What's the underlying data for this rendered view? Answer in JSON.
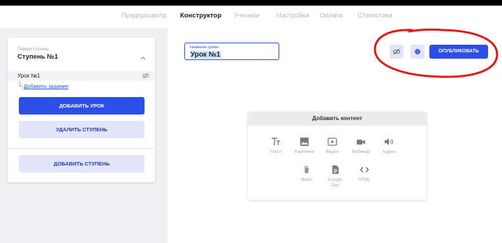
{
  "nav": {
    "tabs": [
      {
        "label": "Предпросмотр",
        "active": false
      },
      {
        "label": "Конструктор",
        "active": true
      },
      {
        "label": "Ученики",
        "active": false
      },
      {
        "label": "Настройки",
        "active": false
      },
      {
        "label": "Оплата",
        "active": false
      },
      {
        "label": "Статистика",
        "active": false
      }
    ]
  },
  "sidebar": {
    "stage_sub": "Первая ступень",
    "stage_title": "Ступень №1",
    "lesson_label": "Урок №1",
    "add_task_link": "Добавить задание",
    "add_lesson_button": "ДОБАВИТЬ УРОК",
    "delete_stage_button": "УДАЛИТЬ СТУПЕНЬ",
    "add_stage_button": "ДОБАВИТЬ СТУПЕНЬ"
  },
  "editor": {
    "lesson_name_label": "Название урока",
    "lesson_name_value": "Урок №1",
    "publish_button": "ОПУБЛИКОВАТЬ"
  },
  "content": {
    "title": "Добавить контент",
    "items": [
      {
        "label": "Текст",
        "icon": "text-icon"
      },
      {
        "label": "Картинка",
        "icon": "image-icon"
      },
      {
        "label": "Видео",
        "icon": "video-icon"
      },
      {
        "label": "Вебинар",
        "icon": "webinar-icon"
      },
      {
        "label": "Аудио",
        "icon": "audio-icon"
      },
      {
        "label": "Файл",
        "icon": "file-icon"
      },
      {
        "label": "Google Doc",
        "icon": "google-doc-icon"
      },
      {
        "label": "HTML",
        "icon": "html-icon"
      }
    ]
  },
  "colors": {
    "accent": "#2b4fe8",
    "accent_light": "#e2e6fb",
    "annotation_red": "#e01818"
  }
}
